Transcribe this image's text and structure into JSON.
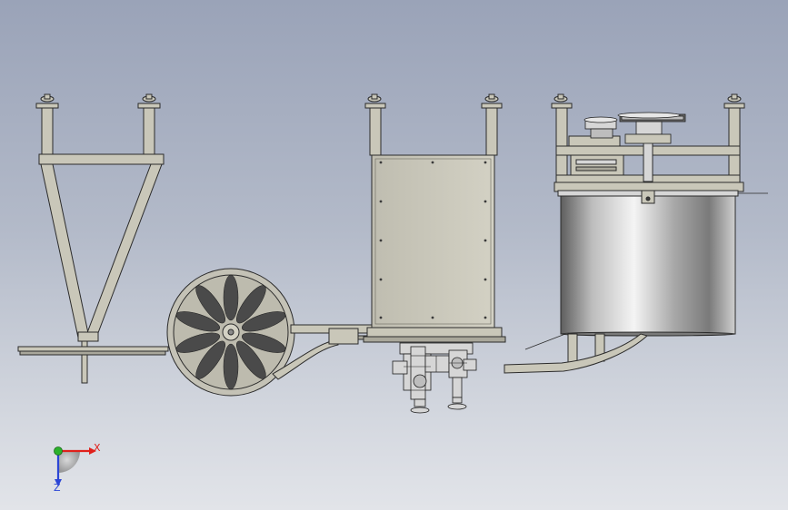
{
  "view": {
    "background_top": "#9aa3b8",
    "background_bottom": "#e2e4e9"
  },
  "colors": {
    "frame_fill": "#c9c7b9",
    "frame_stroke": "#2b2b2b",
    "steel_light": "#eeeeee",
    "steel_dark": "#6c6c6c",
    "wheel_fill": "#c4c2b6",
    "axis_x": "#e0201b",
    "axis_y": "#2bb12b",
    "axis_z": "#2b45d6"
  },
  "triad": {
    "x_label": "X",
    "z_label": "Z"
  },
  "parts": {
    "hopper": "hopper-frame",
    "spreader_wheel": "spoked-wheel",
    "cabinet": "control-cabinet",
    "pump": "pump-assembly",
    "tank": "steel-tank",
    "pulley": "belt-pulley"
  }
}
